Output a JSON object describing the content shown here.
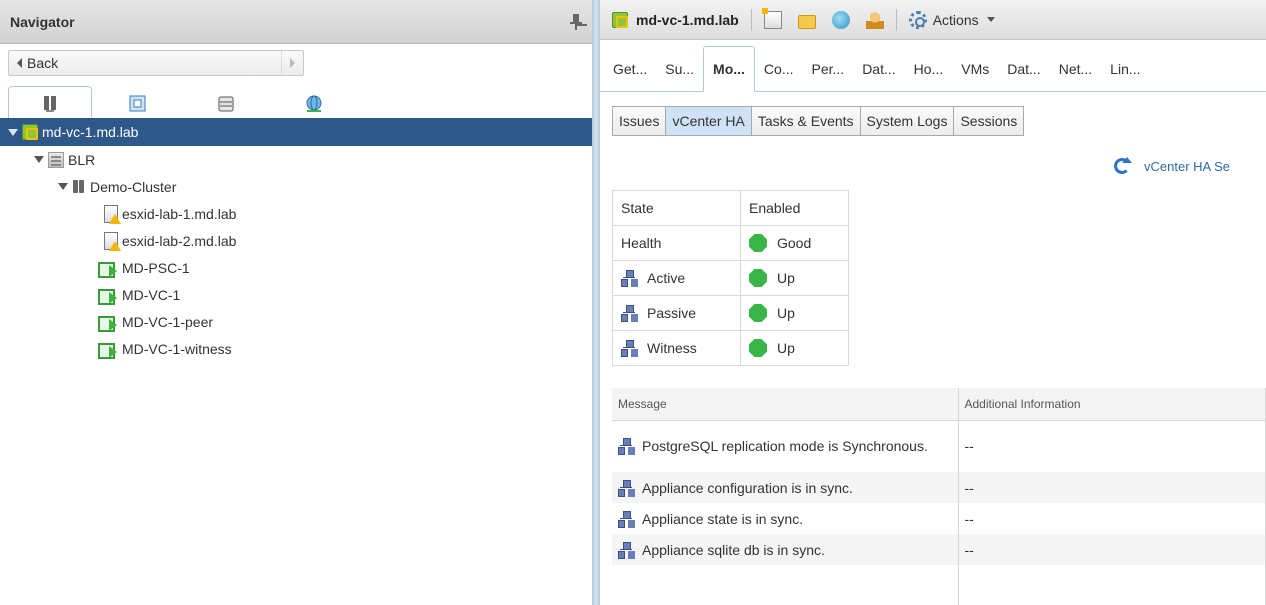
{
  "navigator": {
    "title": "Navigator",
    "back_label": "Back",
    "tree": [
      {
        "label": "md-vc-1.md.lab",
        "icon": "vcenter-icon",
        "selected": true
      },
      {
        "label": "BLR",
        "icon": "datacenter-icon"
      },
      {
        "label": "Demo-Cluster",
        "icon": "cluster-icon"
      },
      {
        "label": "esxid-lab-1.md.lab",
        "icon": "host-warning-icon"
      },
      {
        "label": "esxid-lab-2.md.lab",
        "icon": "host-warning-icon"
      },
      {
        "label": "MD-PSC-1",
        "icon": "vm-icon"
      },
      {
        "label": "MD-VC-1",
        "icon": "vm-icon"
      },
      {
        "label": "MD-VC-1-peer",
        "icon": "vm-icon"
      },
      {
        "label": "MD-VC-1-witness",
        "icon": "vm-icon"
      }
    ]
  },
  "toolbar": {
    "object_title": "md-vc-1.md.lab",
    "actions_label": "Actions"
  },
  "tabs": [
    "Get...",
    "Su...",
    "Mo...",
    "Co...",
    "Per...",
    "Dat...",
    "Ho...",
    "VMs",
    "Dat...",
    "Net...",
    "Lin..."
  ],
  "active_tab": "Mo...",
  "subtabs": [
    "Issues",
    "vCenter HA",
    "Tasks & Events",
    "System Logs",
    "Sessions"
  ],
  "active_subtab": "vCenter HA",
  "ha_settings_link": "vCenter HA Se",
  "state_table": {
    "state_label": "State",
    "state_value": "Enabled",
    "health_label": "Health",
    "health_value": "Good",
    "nodes": [
      {
        "label": "Active",
        "value": "Up"
      },
      {
        "label": "Passive",
        "value": "Up"
      },
      {
        "label": "Witness",
        "value": "Up"
      }
    ]
  },
  "messages": {
    "col_message": "Message",
    "col_info": "Additional Information",
    "rows": [
      {
        "message": "PostgreSQL replication mode is Synchronous.",
        "info": "--"
      },
      {
        "message": "Appliance configuration is in sync.",
        "info": "--"
      },
      {
        "message": "Appliance state is in sync.",
        "info": "--"
      },
      {
        "message": "Appliance sqlite db is in sync.",
        "info": "--"
      }
    ]
  },
  "colors": {
    "accent": "#2d5889",
    "status_ok": "#3ab54a",
    "link": "#2f6aa6"
  }
}
